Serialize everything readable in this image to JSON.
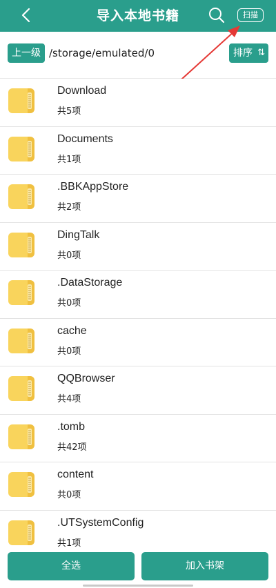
{
  "header": {
    "title": "导入本地书籍",
    "scan_label": "扫描",
    "background": "#2a9e8c"
  },
  "pathbar": {
    "up_label": "上一级",
    "path": "/storage/emulated/0",
    "sort_label": "排序",
    "sort_arrows": "⇅"
  },
  "annotation": {
    "arrow_color": "#e53935"
  },
  "folders": [
    {
      "name": "Download",
      "count": "共5项"
    },
    {
      "name": "Documents",
      "count": "共1项"
    },
    {
      "name": ".BBKAppStore",
      "count": "共2项"
    },
    {
      "name": "DingTalk",
      "count": "共0项"
    },
    {
      "name": ".DataStorage",
      "count": "共0项"
    },
    {
      "name": "cache",
      "count": "共0项"
    },
    {
      "name": "QQBrowser",
      "count": "共4项"
    },
    {
      "name": ".tomb",
      "count": "共42项"
    },
    {
      "name": "content",
      "count": "共0项"
    },
    {
      "name": ".UTSystemConfig",
      "count": "共1项"
    }
  ],
  "bottom": {
    "select_all_label": "全选",
    "add_shelf_label": "加入书架"
  }
}
